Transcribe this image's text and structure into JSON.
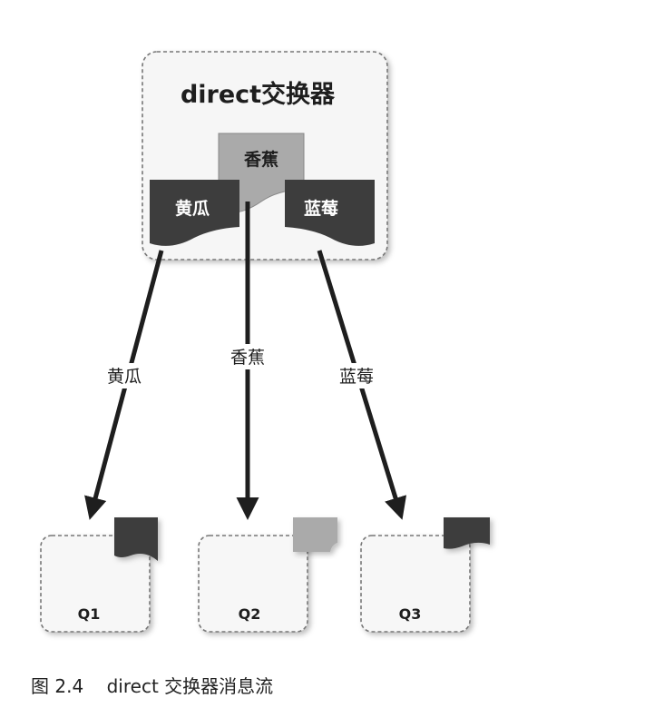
{
  "exchange": {
    "title": "direct交换器"
  },
  "messages": [
    {
      "id": "cucumber",
      "label": "黄瓜",
      "color": "#3d3d3d"
    },
    {
      "id": "banana",
      "label": "香蕉",
      "color": "#aaaaaa"
    },
    {
      "id": "blueberry",
      "label": "蓝莓",
      "color": "#3d3d3d"
    }
  ],
  "bindings": [
    {
      "label": "黄瓜",
      "to": "Q1"
    },
    {
      "label": "香蕉",
      "to": "Q2"
    },
    {
      "label": "蓝莓",
      "to": "Q3"
    }
  ],
  "queues": [
    {
      "label": "Q1",
      "message_color": "#3d3d3d"
    },
    {
      "label": "Q2",
      "message_color": "#aaaaaa"
    },
    {
      "label": "Q3",
      "message_color": "#3d3d3d"
    }
  ],
  "caption": {
    "figure": "图 2.4",
    "text": "direct 交换器消息流"
  }
}
